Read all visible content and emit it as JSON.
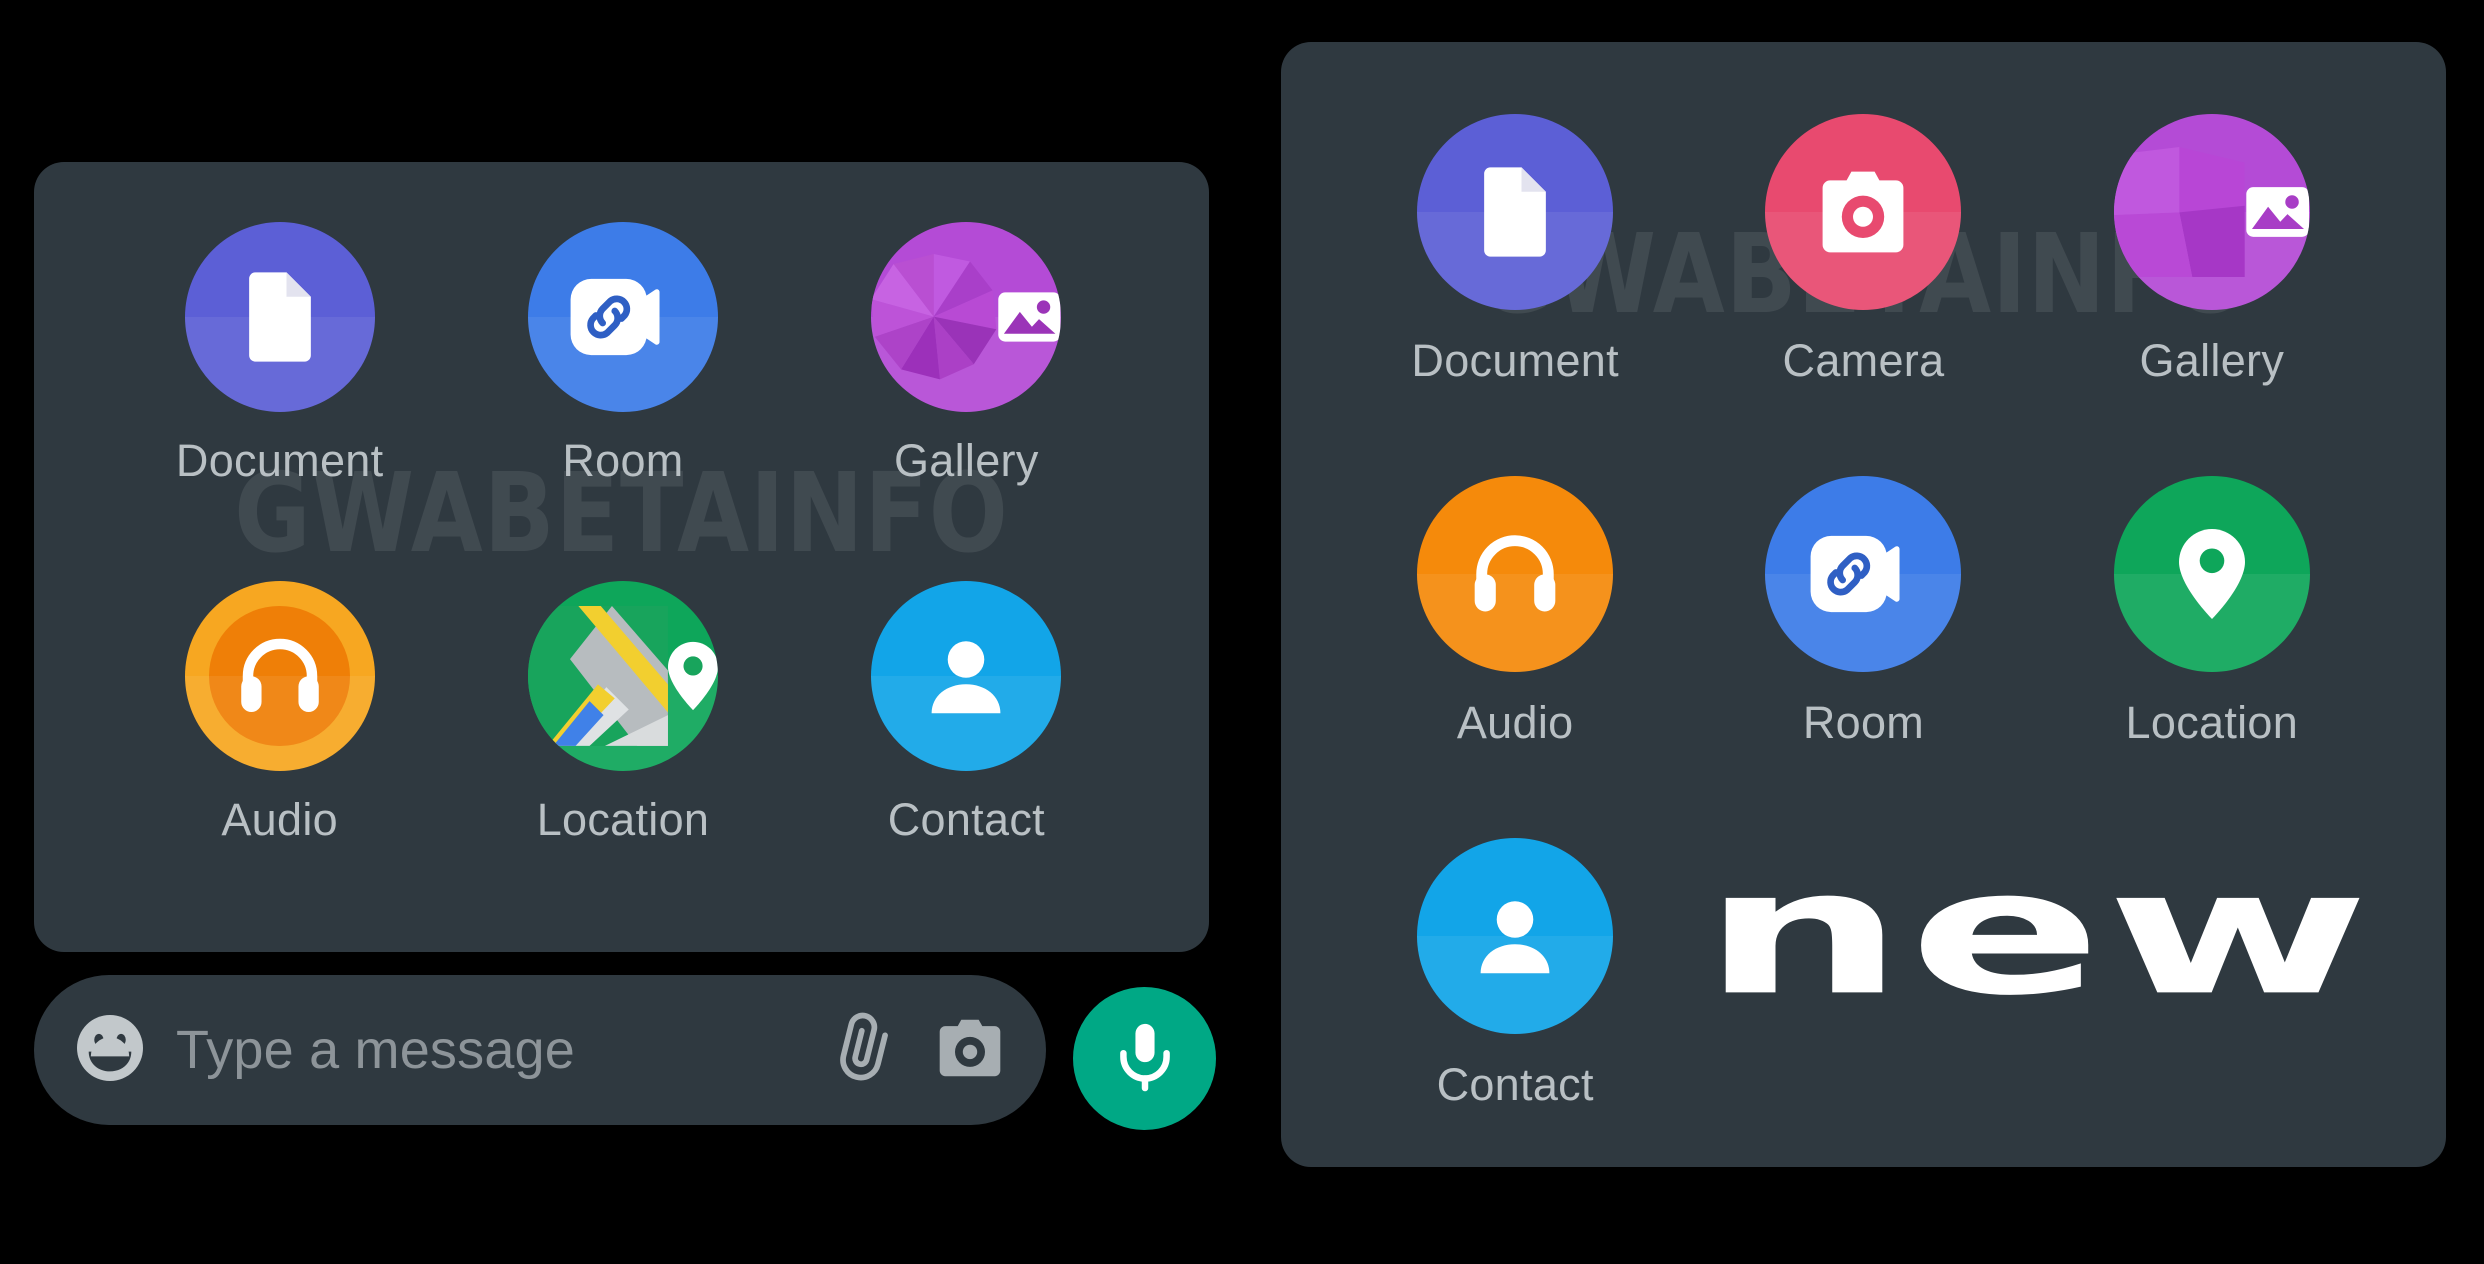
{
  "watermark": {
    "text": "GWABETAINFO"
  },
  "colors": {
    "page_background": "#000000",
    "panel_background": "#2f3940",
    "label_text": "#b9c0c4",
    "placeholder_text": "#8d9499",
    "mic_button": "#00a885",
    "document": "#5c5fd6",
    "camera": "#e84a6f",
    "gallery": "#b44bd6",
    "audio": "#f58a0b",
    "audio_ring": "#f7a721",
    "room": "#3d7ce8",
    "location": "#0ea65a",
    "contact": "#12a5e8",
    "new_badge": "#ffffff"
  },
  "old_panel": {
    "name": "old-attachment-sheet",
    "items": [
      {
        "label": "Document",
        "icon": "document-icon",
        "color": "#5c5fd6"
      },
      {
        "label": "Room",
        "icon": "room-icon",
        "color": "#3d7ce8"
      },
      {
        "label": "Gallery",
        "icon": "gallery-icon",
        "color": "#b44bd6"
      },
      {
        "label": "Audio",
        "icon": "audio-icon",
        "color": "#ef7f07"
      },
      {
        "label": "Location",
        "icon": "location-icon",
        "color": "#0ea65a"
      },
      {
        "label": "Contact",
        "icon": "contact-icon",
        "color": "#12a5e8"
      }
    ]
  },
  "new_panel": {
    "name": "new-attachment-sheet",
    "badge": "new",
    "items": [
      {
        "label": "Document",
        "icon": "document-icon",
        "color": "#5c5fd6"
      },
      {
        "label": "Camera",
        "icon": "camera-icon",
        "color": "#e84a6f"
      },
      {
        "label": "Gallery",
        "icon": "gallery-icon",
        "color": "#b44bd6"
      },
      {
        "label": "Audio",
        "icon": "audio-icon",
        "color": "#f58a0b"
      },
      {
        "label": "Room",
        "icon": "room-icon",
        "color": "#3d7ce8"
      },
      {
        "label": "Location",
        "icon": "location-icon",
        "color": "#0ea65a"
      },
      {
        "label": "Contact",
        "icon": "contact-icon",
        "color": "#12a5e8"
      }
    ]
  },
  "input_bar": {
    "placeholder": "Type a message",
    "value": "",
    "emoji_icon": "smiley-icon",
    "attach_icon": "paperclip-icon",
    "camera_icon": "camera-icon",
    "mic_icon": "microphone-icon"
  }
}
